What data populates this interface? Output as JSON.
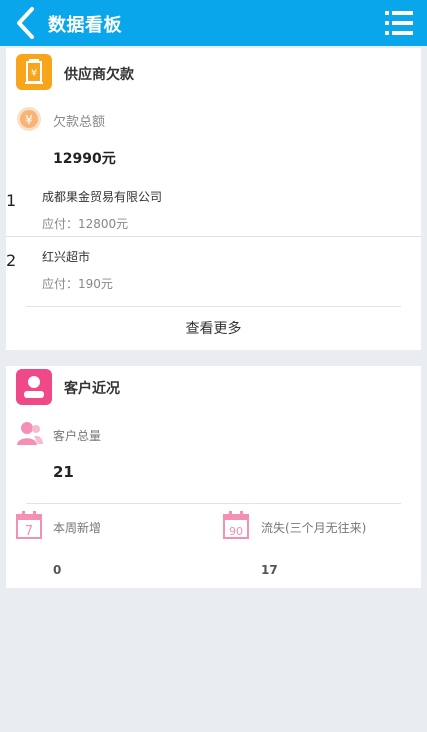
{
  "header": {
    "title": "数据看板",
    "back_icon": "chevron-left-icon",
    "menu_icon": "list-menu-icon"
  },
  "supplier": {
    "title": "供应商欠款",
    "total_label": "欠款总额",
    "total_value": "12990元",
    "items": [
      {
        "index": "1",
        "name": "成都果金贸易有限公司",
        "payable": "应付：12800元"
      },
      {
        "index": "2",
        "name": "红兴超市",
        "payable": "应付：190元"
      }
    ],
    "more_label": "查看更多"
  },
  "customer": {
    "title": "客户近况",
    "total_label": "客户总量",
    "total_value": "21",
    "weekly_icon_text": "7",
    "weekly_label": "本周新增",
    "weekly_value": "0",
    "lost_icon_text": "90",
    "lost_label": "流失(三个月无往来)",
    "lost_value": "17"
  },
  "colors": {
    "header": "#0aa6ec",
    "orange": "#f8a51c",
    "pink": "#f0498a",
    "coin": "#f6b577",
    "pink_light": "#f48fb5"
  }
}
